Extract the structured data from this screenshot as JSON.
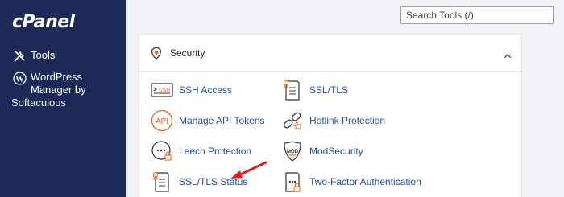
{
  "app": {
    "logo_text": "cPanel"
  },
  "sidebar": {
    "items": [
      {
        "label": "Tools",
        "icon": "tools-icon"
      },
      {
        "label_line1": "WordPress",
        "label_line2": "Manager by",
        "label_line3": "Softaculous",
        "icon": "wordpress-icon"
      }
    ]
  },
  "search": {
    "placeholder": "Search Tools (/)"
  },
  "security": {
    "title": "Security",
    "accent_color": "#e8601c",
    "link_color": "#1f4e9c",
    "tools": [
      {
        "label": "SSH Access",
        "icon": "ssh-icon"
      },
      {
        "label": "SSL/TLS",
        "icon": "ssl-certificate-icon"
      },
      {
        "label": "Manage API Tokens",
        "icon": "api-icon"
      },
      {
        "label": "Hotlink Protection",
        "icon": "hotlink-chain-icon"
      },
      {
        "label": "Leech Protection",
        "icon": "leech-protection-icon"
      },
      {
        "label": "ModSecurity",
        "icon": "modsecurity-icon"
      },
      {
        "label": "SSL/TLS Status",
        "icon": "ssl-status-icon"
      },
      {
        "label": "Two-Factor Authentication",
        "icon": "two-factor-icon"
      }
    ],
    "ssh_badge": "SSH",
    "api_badge": "API",
    "mod_badge": "MOD"
  },
  "annotation": {
    "arrow_color": "#e0201c"
  }
}
